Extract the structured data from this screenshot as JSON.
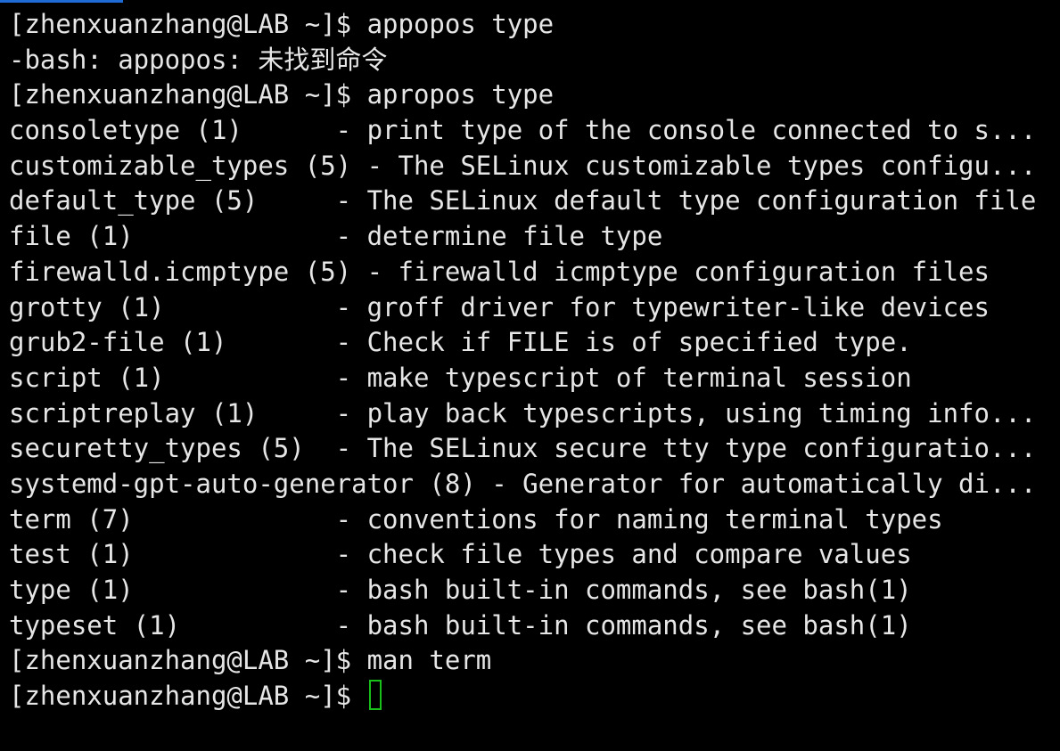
{
  "theme": {
    "background": "#000000",
    "foreground": "#e6e6e6",
    "cursor_color": "#19c019",
    "tab_accent": "#1e6bd6"
  },
  "terminal": {
    "lines": [
      "[zhenxuanzhang@LAB ~]$ appopos type",
      "-bash: appopos: 未找到命令",
      "[zhenxuanzhang@LAB ~]$ apropos type",
      "consoletype (1)      - print type of the console connected to s...",
      "customizable_types (5) - The SELinux customizable types configu...",
      "default_type (5)     - The SELinux default type configuration file",
      "file (1)             - determine file type",
      "firewalld.icmptype (5) - firewalld icmptype configuration files",
      "grotty (1)           - groff driver for typewriter-like devices",
      "grub2-file (1)       - Check if FILE is of specified type.",
      "script (1)           - make typescript of terminal session",
      "scriptreplay (1)     - play back typescripts, using timing info...",
      "securetty_types (5)  - The SELinux secure tty type configuratio...",
      "systemd-gpt-auto-generator (8) - Generator for automatically di...",
      "term (7)             - conventions for naming terminal types",
      "test (1)             - check file types and compare values",
      "type (1)             - bash built-in commands, see bash(1)",
      "typeset (1)          - bash built-in commands, see bash(1)",
      "[zhenxuanzhang@LAB ~]$ man term"
    ],
    "prompt": "[zhenxuanzhang@LAB ~]$ "
  }
}
